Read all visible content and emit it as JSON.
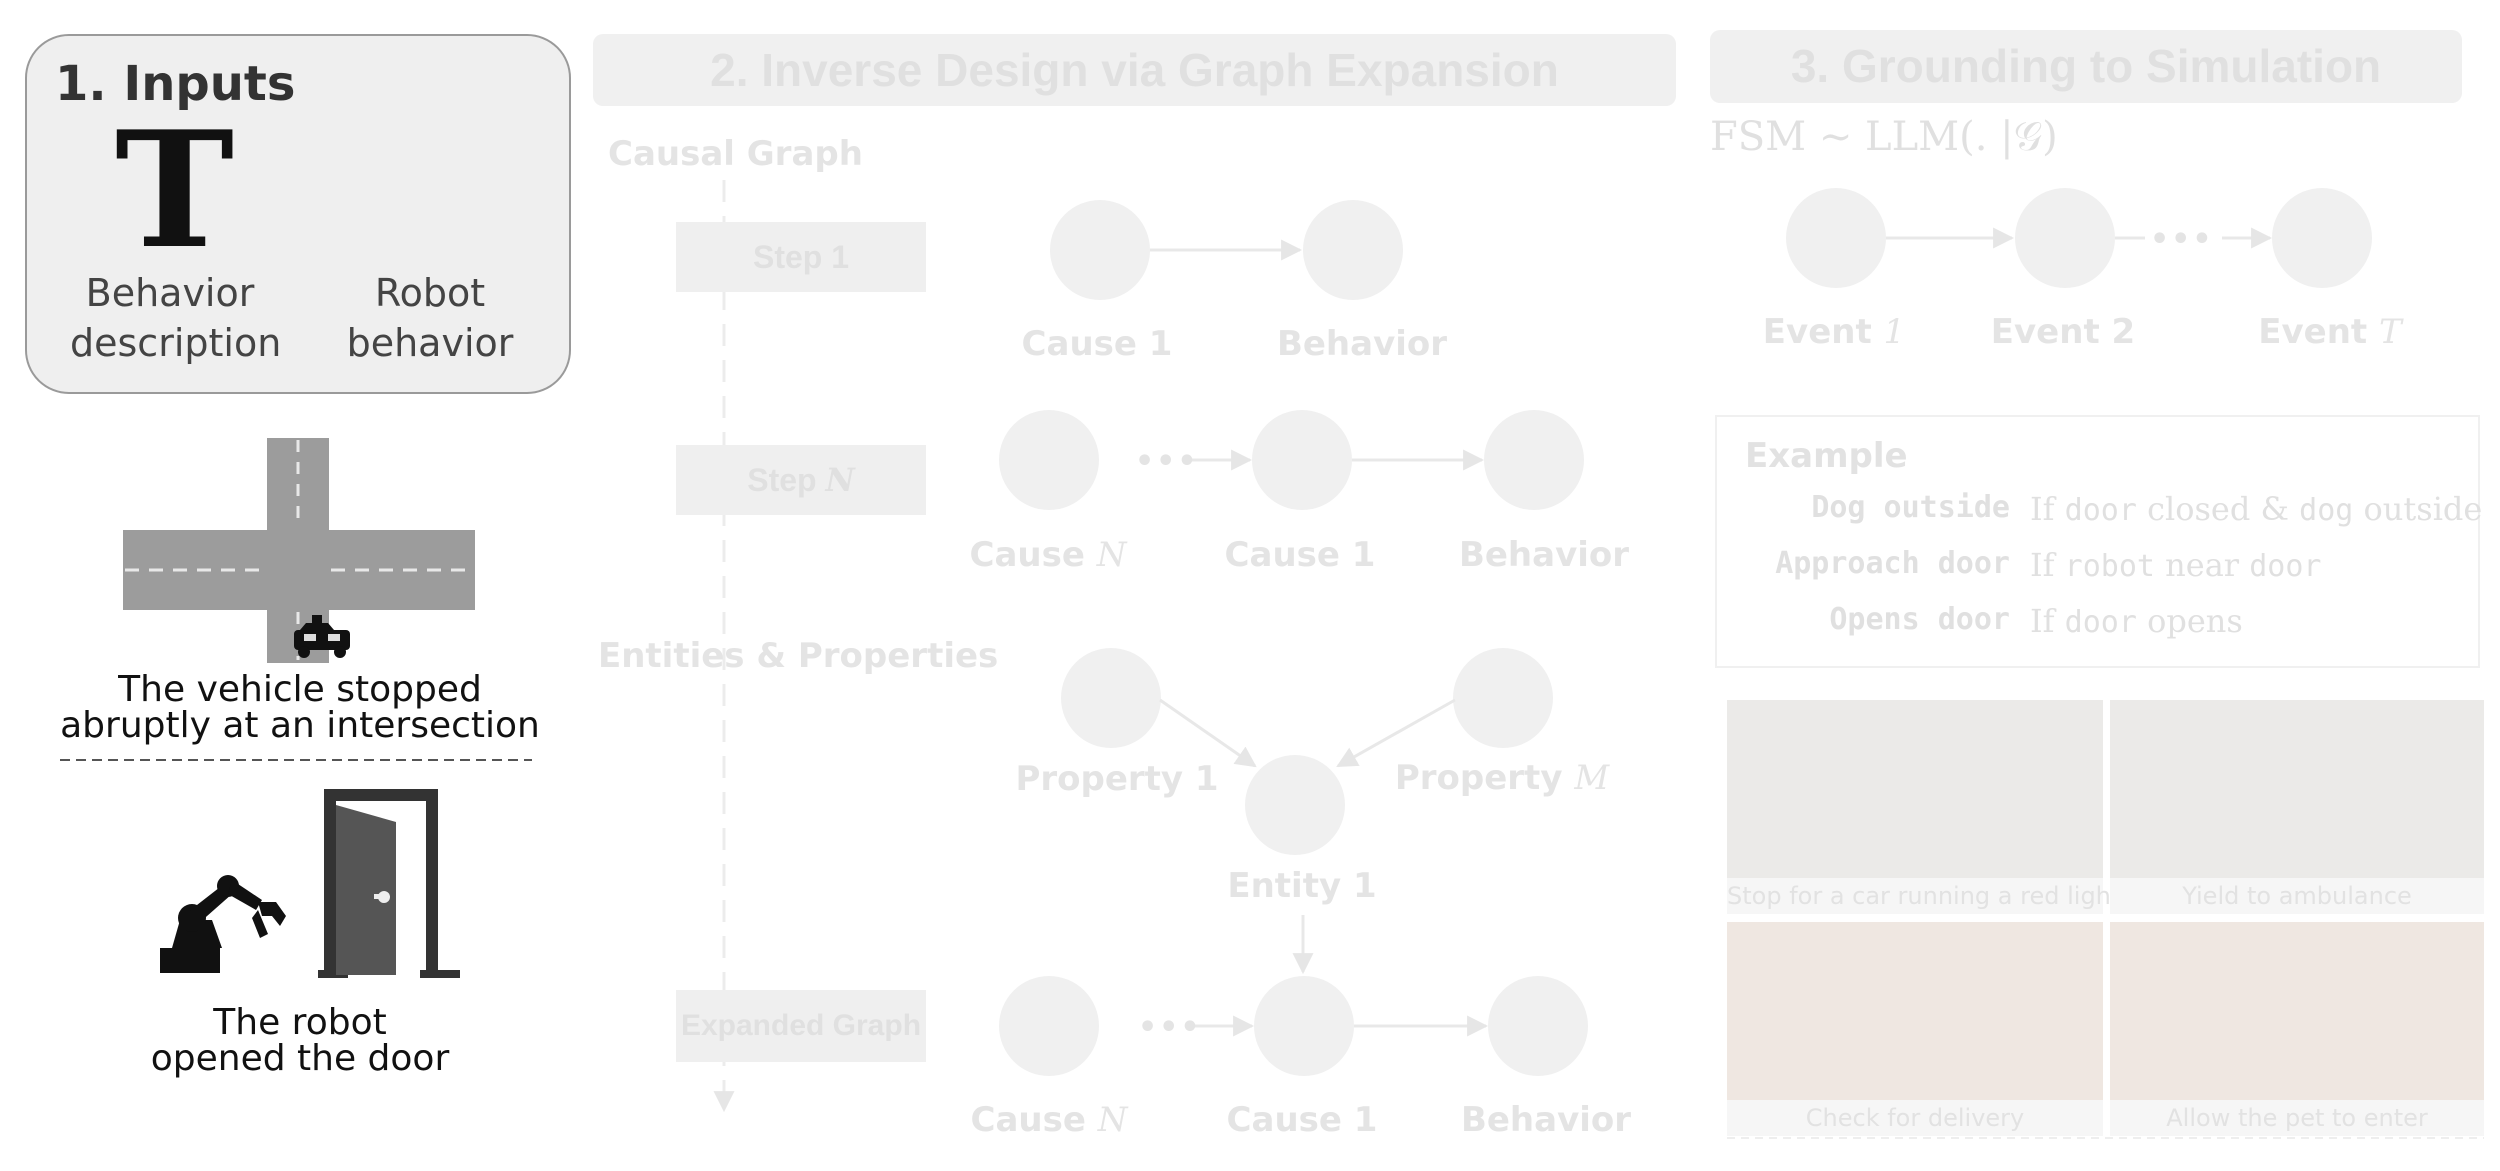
{
  "panel1": {
    "title": "1. Inputs",
    "icon_text_glyph": "T",
    "text_input_label_l1": "Behavior",
    "text_input_label_l2": "description",
    "robot_input_label_l1": "Robot",
    "robot_input_label_l2": "behavior",
    "example1_l1": "The vehicle stopped",
    "example1_l2": "abruptly at an intersection",
    "example2_l1": "The robot",
    "example2_l2": "opened the door"
  },
  "panel2": {
    "title": "2. Inverse Design via Graph Expansion",
    "causal_graph_label": "Causal Graph",
    "step1": "Step 1",
    "stepN_prefix": "Step ",
    "stepN_var": "N",
    "entities_label": "Entities & Properties",
    "expanded_label": "Expanded Graph",
    "cause1": "Cause 1",
    "behavior": "Behavior",
    "causeN_prefix": "Cause ",
    "causeN_var": "N",
    "dots": "•••",
    "property1": "Property 1",
    "propertyM_prefix": "Property ",
    "propertyM_var": "M",
    "entity1": "Entity 1"
  },
  "panel3": {
    "title": "3. Grounding to Simulation",
    "formula": "FSM ∼ LLM(. |𝒢)",
    "event1_prefix": "Event ",
    "event1_var": "1",
    "event2": "Event 2",
    "eventT_prefix": "Event ",
    "eventT_var": "T",
    "dots": "•••",
    "example": {
      "title": "Example",
      "rows": [
        {
          "key": "Dog outside",
          "v1": "If ",
          "c1": "door",
          "v2": " closed ",
          "v3": "& ",
          "c2": "dog",
          "v4": " outside"
        },
        {
          "key": "Approach door",
          "v1": "If ",
          "c1": "robot",
          "v2": " near ",
          "v3": "",
          "c2": "door",
          "v4": ""
        },
        {
          "key": "Opens door",
          "v1": "If ",
          "c1": "door",
          "v2": " opens",
          "v3": "",
          "c2": "",
          "v4": ""
        }
      ]
    },
    "captions": [
      "Stop for a car running a red light",
      "Yield to ambulance",
      "Check for delivery",
      "Allow the pet to enter"
    ]
  },
  "colors": {
    "faded_text": "#e4e4e4",
    "faded_node": "#f0f0f0",
    "panel1_bg": "#efefef",
    "road": "#9a9a9a"
  }
}
